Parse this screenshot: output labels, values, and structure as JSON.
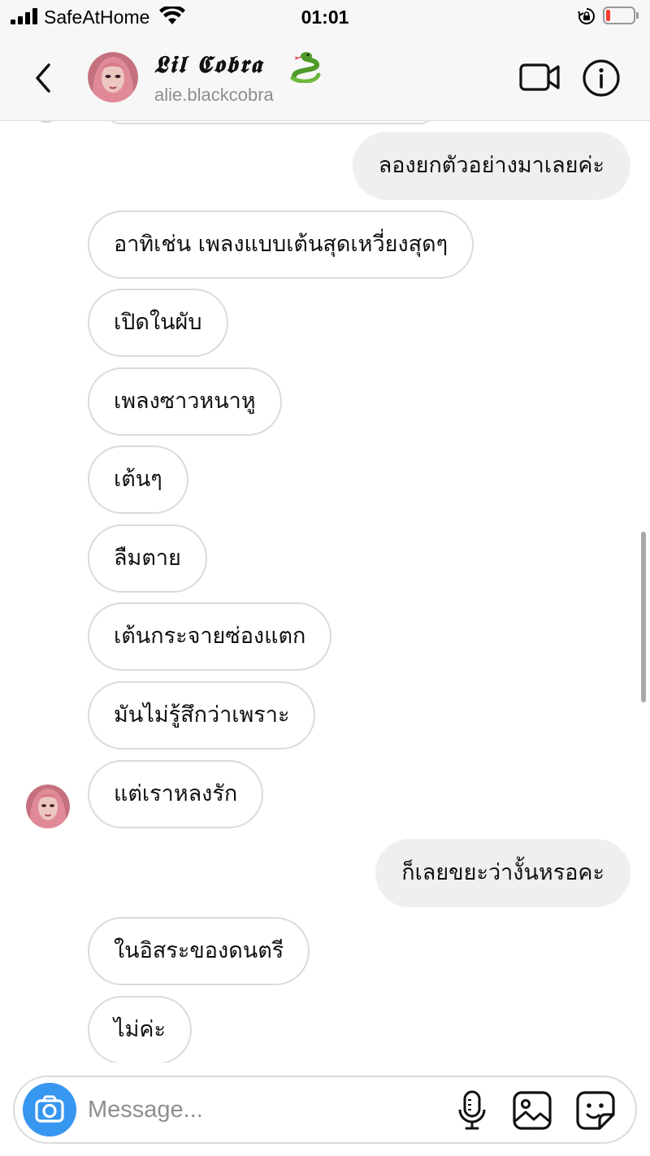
{
  "status_bar": {
    "carrier": "SafeAtHome",
    "time": "01:01",
    "battery_color": "#ff3b30"
  },
  "header": {
    "display_name": "𝕷𝖎𝖑 𝕮𝖔𝖇𝖗𝖆",
    "username": "alie.blackcobra",
    "icons": {
      "back": "chevron-left-icon",
      "snake": "snake-emoji",
      "video": "video-camera-icon",
      "info": "info-circle-icon"
    }
  },
  "messages": [
    {
      "direction": "out",
      "text": "ลองยกตัวอย่างมาเลยค่ะ"
    },
    {
      "direction": "in",
      "text": "อาทิเช่น เพลงแบบเต้นสุดเหวี่ยงสุดๆ"
    },
    {
      "direction": "in",
      "text": "เปิดในผับ"
    },
    {
      "direction": "in",
      "text": "เพลงซาวหนาหู"
    },
    {
      "direction": "in",
      "text": "เต้นๆ"
    },
    {
      "direction": "in",
      "text": "ลืมตาย"
    },
    {
      "direction": "in",
      "text": "เต้นกระจายซ่องแตก"
    },
    {
      "direction": "in",
      "text": "มันไม่รู้สึกว่าเพราะ"
    },
    {
      "direction": "in",
      "text": "แต่เราหลงรัก"
    },
    {
      "direction": "out",
      "text": "ก็เลยขยะว่างั้นหรอคะ"
    },
    {
      "direction": "in",
      "text": "ในอิสระของดนตรี"
    },
    {
      "direction": "in",
      "text": "ไม่ค่ะ"
    }
  ],
  "composer": {
    "placeholder": "Message...",
    "value": "",
    "accent_color": "#3797f0",
    "icons": {
      "camera": "camera-icon",
      "mic": "microphone-icon",
      "gallery": "gallery-icon",
      "sticker": "sticker-icon"
    }
  }
}
